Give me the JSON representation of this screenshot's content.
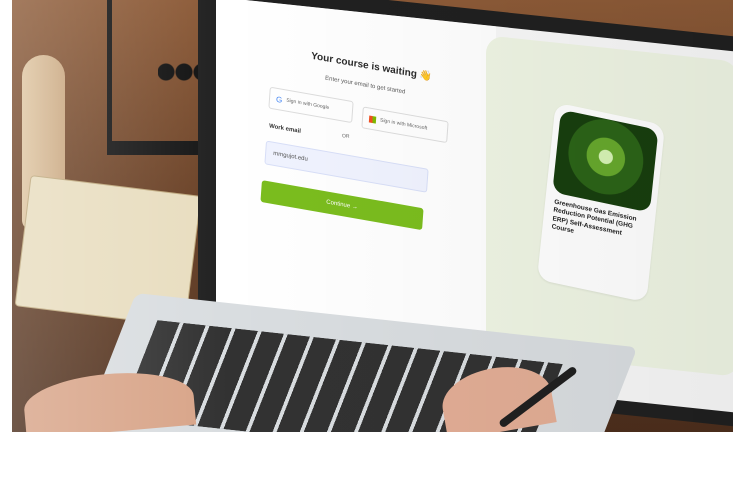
{
  "photo": {
    "login": {
      "title": "Your course is waiting 👋",
      "subtitle": "Enter your email to get started",
      "google_button": "Sign in with Google",
      "microsoft_button": "Sign in with Microsoft",
      "divider": "OR",
      "email_label": "Work email",
      "email_value": "mmgujot.edu",
      "continue_button": "Continue →"
    },
    "course": {
      "title": "Greenhouse Gas Emission Reduction Potential (GHG ERP) Self-Assessment Course"
    }
  },
  "icons": {
    "google": "google-icon",
    "microsoft": "microsoft-icon",
    "forest": "forest-image"
  },
  "colors": {
    "accent": "#7bbd1e",
    "panel": "#eef4e3"
  }
}
